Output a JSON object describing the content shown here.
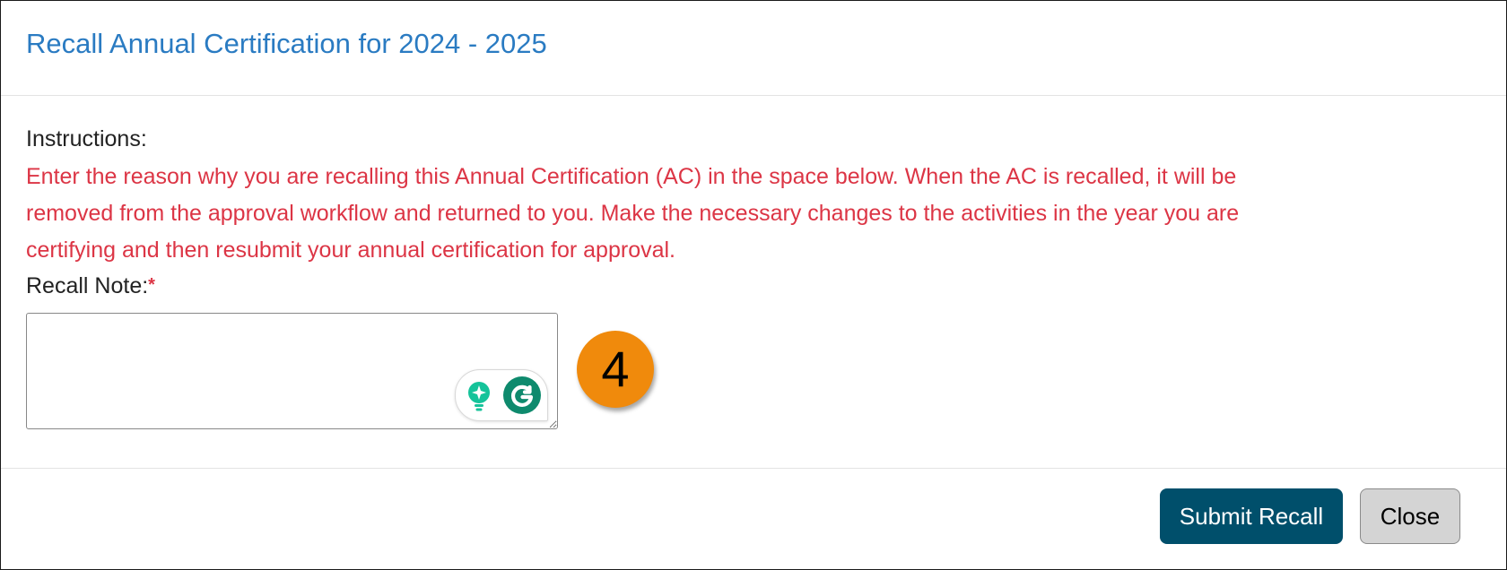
{
  "modal": {
    "title": "Recall Annual Certification for 2024 - 2025"
  },
  "instructions": {
    "label": "Instructions:",
    "lines": [
      "Enter the reason why you are recalling this Annual Certification (AC) in the space below. When the AC is recalled, it will be",
      "removed from the approval workflow and returned to you. Make the necessary changes to the activities in the year you are",
      "certifying and then resubmit your annual certification for approval."
    ]
  },
  "recall_note": {
    "label": "Recall Note:",
    "required_marker": "*",
    "value": "",
    "placeholder": ""
  },
  "step_badge": {
    "number": "4",
    "color": "#f08a0c"
  },
  "footer": {
    "submit_label": "Submit Recall",
    "close_label": "Close"
  },
  "colors": {
    "title": "#2a7bc2",
    "instructions": "#dc3545",
    "submit_bg": "#004f6b",
    "close_bg": "#d4d4d4"
  },
  "icons": {
    "grammarly_suggest": "lightbulb-icon",
    "grammarly_logo": "grammarly-g-icon",
    "resize_handle": "resize-grip-icon"
  }
}
